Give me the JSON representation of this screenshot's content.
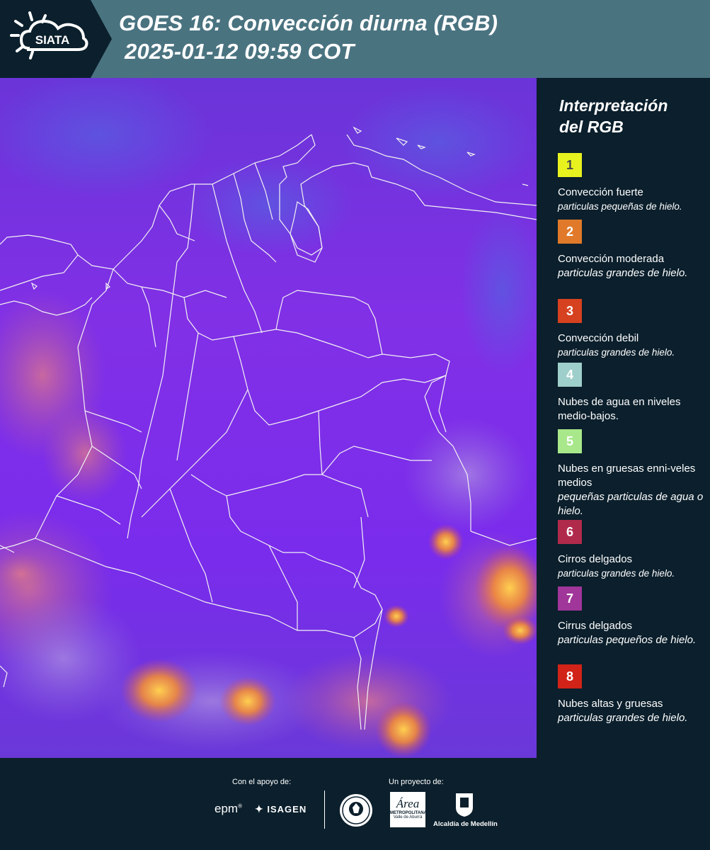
{
  "header": {
    "logo_text": "SIATA",
    "title_line1": "GOES 16: Convección diurna (RGB)",
    "title_line2": "2025-01-12 09:59 COT"
  },
  "legend": {
    "title_line1": "Interpretación",
    "title_line2": "del RGB",
    "items": [
      {
        "number": "1",
        "color": "#e8f21e",
        "name": "Convección fuerte",
        "desc": "particulas pequeñas de hielo."
      },
      {
        "number": "2",
        "color": "#e07a2a",
        "name": "Convección moderada",
        "desc": "particulas grandes de hielo."
      },
      {
        "number": "3",
        "color": "#d6411f",
        "name": "Convección debil",
        "desc": "particulas grandes de hielo."
      },
      {
        "number": "4",
        "color": "#9fcfca",
        "name": "Nubes de agua en niveles medio-bajos.",
        "desc": ""
      },
      {
        "number": "5",
        "color": "#a8e88a",
        "name": "Nubes en gruesas enni-veles medios",
        "desc": "pequeñas particulas de agua o hielo."
      },
      {
        "number": "6",
        "color": "#b02a4c",
        "name": "Cirros delgados",
        "desc": "particulas grandes de hielo."
      },
      {
        "number": "7",
        "color": "#a0359a",
        "name": "Cirrus delgados",
        "desc": "particulas pequeños de hielo."
      },
      {
        "number": "8",
        "color": "#d22318",
        "name": "Nubes altas y gruesas",
        "desc": "particulas grandes de hielo."
      }
    ]
  },
  "footer": {
    "support_label": "Con el apoyo de:",
    "project_label": "Un proyecto de:",
    "sponsor1": "epm",
    "sponsor2": "ISAGEN",
    "partner1": "",
    "partner2_line1": "Área",
    "partner2_line2": "METROPOLITANA",
    "partner2_line3": "Valle de Aburrá",
    "partner3": "Alcaldía de Medellín"
  },
  "colors": {
    "header_bg": "#4a7380",
    "panel_bg": "#0b1f2c",
    "map_base": "#7a2fe6"
  }
}
